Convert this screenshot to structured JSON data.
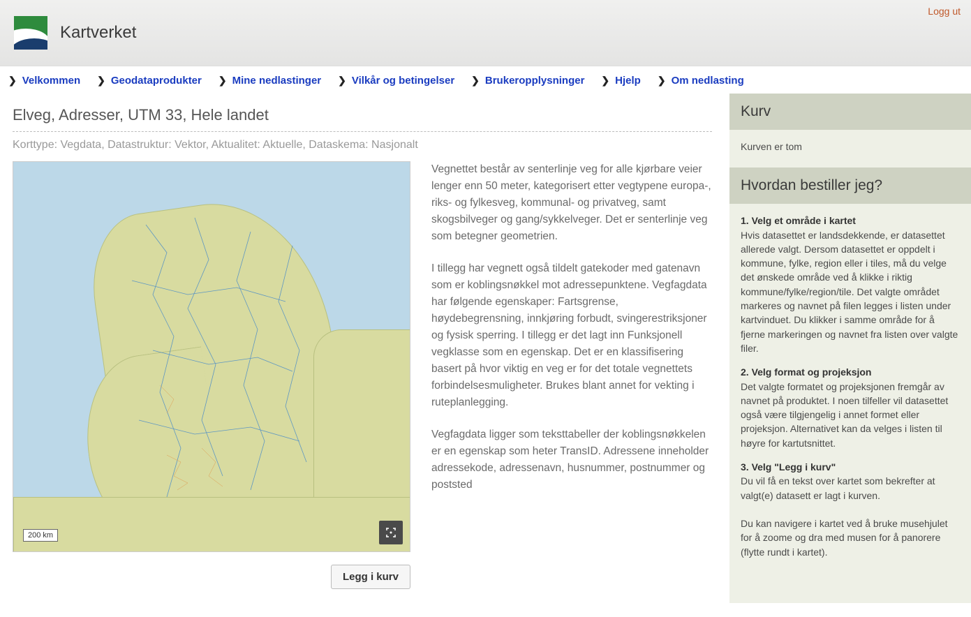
{
  "header": {
    "site_title": "Kartverket",
    "logout": "Logg ut"
  },
  "nav": [
    "Velkommen",
    "Geodataprodukter",
    "Mine nedlastinger",
    "Vilkår og betingelser",
    "Brukeropplysninger",
    "Hjelp",
    "Om nedlasting"
  ],
  "main": {
    "title": "Elveg, Adresser, UTM 33, Hele landet",
    "meta": "Korttype: Vegdata, Datastruktur: Vektor, Aktualitet: Aktuelle, Dataskema: Nasjonalt",
    "scale_label": "200 km",
    "add_to_cart": "Legg i kurv",
    "desc_p1": "Vegnettet består av senterlinje veg for alle kjørbare veier lenger enn 50 meter, kategorisert etter vegtypene europa-, riks- og fylkesveg, kommunal- og privatveg, samt skogsbilveger og gang/sykkelveger. Det er senterlinje veg som betegner geometrien.",
    "desc_p2": "I tillegg har vegnett også tildelt gatekoder med gatenavn som er koblingsnøkkel mot adressepunktene. Vegfagdata har følgende egenskaper: Fartsgrense, høydebegrensning, innkjøring forbudt, svingerestriksjoner og fysisk sperring. I tillegg er det lagt inn Funksjonell vegklasse som en egenskap. Det er en klassifisering basert på hvor viktig en veg er for det totale vegnettets forbindelsesmuligheter. Brukes blant annet for vekting i ruteplanlegging.",
    "desc_p3": "Vegfagdata ligger som teksttabeller der koblingsnøkkelen er en egenskap som heter TransID. Adressene inneholder adressekode, adressenavn, husnummer, postnummer og poststed"
  },
  "sidebar": {
    "cart_title": "Kurv",
    "cart_empty": "Kurven er tom",
    "how_title": "Hvordan bestiller jeg?",
    "step1_h": "1. Velg et område i kartet",
    "step1_p": "Hvis datasettet er landsdekkende, er datasettet allerede valgt.\nDersom datasettet er oppdelt i kommune, fylke, region eller i tiles, må du velge det ønskede område ved å klikke i riktig kommune/fylke/region/tile. Det valgte området markeres og navnet på filen legges i listen under kartvinduet. Du klikker i samme område for å fjerne markeringen og navnet fra listen over valgte filer.",
    "step2_h": "2. Velg format og projeksjon",
    "step2_p": "Det valgte formatet og projeksjonen fremgår av navnet på produktet. I noen tilfeller vil datasettet også være tilgjengelig i annet formet eller projeksjon. Alternativet kan da velges i listen til høyre for kartutsnittet.",
    "step3_h": "3. Velg \"Legg i kurv\"",
    "step3_p": "Du vil få en tekst over kartet som bekrefter at valgt(e) datasett er lagt i kurven.",
    "nav_note": "Du kan navigere i kartet ved å bruke musehjulet for å zoome og dra med musen for å panorere (flytte rundt i kartet)."
  }
}
